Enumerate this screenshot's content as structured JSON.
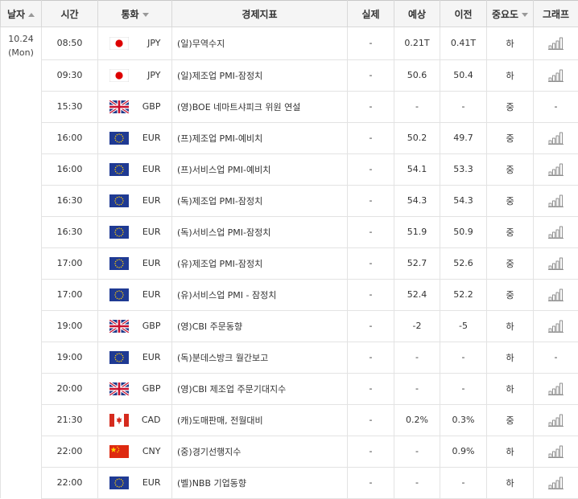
{
  "headers": {
    "date": "날자",
    "time": "시간",
    "currency": "통화",
    "indicator": "경제지표",
    "actual": "실제",
    "forecast": "예상",
    "previous": "이전",
    "importance": "중요도",
    "graph": "그래프"
  },
  "date": {
    "day": "10.24",
    "weekday": "(Mon)"
  },
  "rows": [
    {
      "time": "08:50",
      "flag": "JP",
      "currency": "JPY",
      "indicator": "(일)무역수지",
      "actual": "-",
      "forecast": "0.21T",
      "previous": "0.41T",
      "importance": "하",
      "graph": true
    },
    {
      "time": "09:30",
      "flag": "JP",
      "currency": "JPY",
      "indicator": "(일)제조업 PMI-잠정치",
      "actual": "-",
      "forecast": "50.6",
      "previous": "50.4",
      "importance": "하",
      "graph": true
    },
    {
      "time": "15:30",
      "flag": "GB",
      "currency": "GBP",
      "indicator": "(영)BOE 네마트샤피크 위원 연설",
      "actual": "-",
      "forecast": "-",
      "previous": "-",
      "importance": "중",
      "graph": false
    },
    {
      "time": "16:00",
      "flag": "EU",
      "currency": "EUR",
      "indicator": "(프)제조업 PMI-예비치",
      "actual": "-",
      "forecast": "50.2",
      "previous": "49.7",
      "importance": "중",
      "graph": true
    },
    {
      "time": "16:00",
      "flag": "EU",
      "currency": "EUR",
      "indicator": "(프)서비스업 PMI-예비치",
      "actual": "-",
      "forecast": "54.1",
      "previous": "53.3",
      "importance": "중",
      "graph": true
    },
    {
      "time": "16:30",
      "flag": "EU",
      "currency": "EUR",
      "indicator": "(독)제조업 PMI-잠정치",
      "actual": "-",
      "forecast": "54.3",
      "previous": "54.3",
      "importance": "중",
      "graph": true
    },
    {
      "time": "16:30",
      "flag": "EU",
      "currency": "EUR",
      "indicator": "(독)서비스업 PMI-잠정치",
      "actual": "-",
      "forecast": "51.9",
      "previous": "50.9",
      "importance": "중",
      "graph": true
    },
    {
      "time": "17:00",
      "flag": "EU",
      "currency": "EUR",
      "indicator": "(유)제조업 PMI-잠정치",
      "actual": "-",
      "forecast": "52.7",
      "previous": "52.6",
      "importance": "중",
      "graph": true
    },
    {
      "time": "17:00",
      "flag": "EU",
      "currency": "EUR",
      "indicator": "(유)서비스업 PMI - 잠정치",
      "actual": "-",
      "forecast": "52.4",
      "previous": "52.2",
      "importance": "중",
      "graph": true
    },
    {
      "time": "19:00",
      "flag": "GB",
      "currency": "GBP",
      "indicator": "(영)CBI 주문동향",
      "actual": "-",
      "forecast": "-2",
      "previous": "-5",
      "importance": "하",
      "graph": true
    },
    {
      "time": "19:00",
      "flag": "EU",
      "currency": "EUR",
      "indicator": "(독)분데스방크 월간보고",
      "actual": "-",
      "forecast": "-",
      "previous": "-",
      "importance": "하",
      "graph": false
    },
    {
      "time": "20:00",
      "flag": "GB",
      "currency": "GBP",
      "indicator": "(영)CBI 제조업 주문기대지수",
      "actual": "-",
      "forecast": "-",
      "previous": "-",
      "importance": "하",
      "graph": true
    },
    {
      "time": "21:30",
      "flag": "CA",
      "currency": "CAD",
      "indicator": "(캐)도매판매, 전월대비",
      "actual": "-",
      "forecast": "0.2%",
      "previous": "0.3%",
      "importance": "중",
      "graph": true
    },
    {
      "time": "22:00",
      "flag": "CN",
      "currency": "CNY",
      "indicator": "(중)경기선행지수",
      "actual": "-",
      "forecast": "-",
      "previous": "0.9%",
      "importance": "하",
      "graph": true
    },
    {
      "time": "22:00",
      "flag": "EU",
      "currency": "EUR",
      "indicator": "(벨)NBB 기업동향",
      "actual": "-",
      "forecast": "-",
      "previous": "-",
      "importance": "하",
      "graph": true
    }
  ],
  "no_graph_text": "-",
  "colors": {
    "header_bg": "#f5f5f5",
    "border": "#e3e3e3",
    "text": "#333333"
  }
}
